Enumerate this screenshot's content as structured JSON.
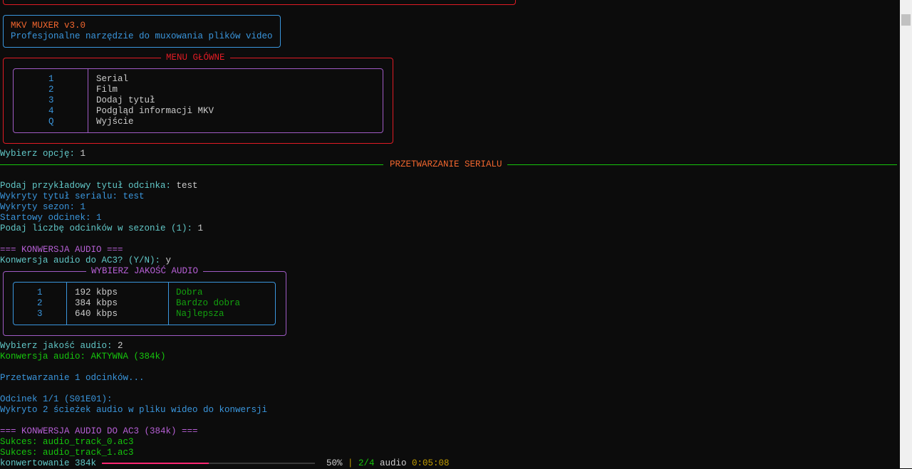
{
  "header": {
    "title": "MKV MUXER v3.0",
    "subtitle": "Profesjonalne narzędzie do muxowania plików video"
  },
  "menu": {
    "title": "MENU GŁÓWNE",
    "items": [
      {
        "key": "1",
        "label": "Serial"
      },
      {
        "key": "2",
        "label": "Film"
      },
      {
        "key": "3",
        "label": "Dodaj tytuł"
      },
      {
        "key": "4",
        "label": "Podgląd informacji MKV"
      },
      {
        "key": "Q",
        "label": "Wyjście"
      }
    ]
  },
  "prompt_option": {
    "label": "Wybierz opcję: ",
    "value": "1"
  },
  "section_title": "PRZETWARZANIE SERIALU",
  "series": {
    "title_prompt": "Podaj przykładowy tytuł odcinka: ",
    "title_value": "test",
    "detected_title": "Wykryty tytuł serialu: test",
    "detected_season": "Wykryty sezon: 1",
    "start_episode": "Startowy odcinek: 1",
    "count_prompt": "Podaj liczbę odcinków w sezonie (1): ",
    "count_value": "1"
  },
  "audio": {
    "header": "=== KONWERSJA AUDIO ===",
    "prompt": "Konwersja audio do AC3? (Y/N): ",
    "prompt_value": "y",
    "quality_title": "WYBIERZ JAKOŚĆ AUDIO",
    "qualities": [
      {
        "key": "1",
        "bitrate": "192 kbps",
        "label": "Dobra"
      },
      {
        "key": "2",
        "bitrate": "384 kbps",
        "label": "Bardzo dobra"
      },
      {
        "key": "3",
        "bitrate": "640 kbps",
        "label": "Najlepsza"
      }
    ],
    "quality_prompt": "Wybierz jakość audio: ",
    "quality_value": "2",
    "status": "Konwersja audio: AKTYWNA (384k)"
  },
  "processing": {
    "count": "Przetwarzanie 1 odcinków...",
    "episode": "Odcinek 1/1 (S01E01):",
    "detected_tracks": "Wykryto 2 ścieżek audio w pliku wideo do konwersji",
    "ac3_header": "=== KONWERSJA AUDIO DO AC3 (384k) ===",
    "success": [
      "Sukces: audio_track_0.ac3",
      "Sukces: audio_track_1.ac3"
    ]
  },
  "progress": {
    "label": "konwertowanie 384k",
    "percent": 50,
    "percent_text": "50%",
    "sep": "|",
    "count": "2/4",
    "unit": "audio",
    "time": "0:05:08"
  }
}
